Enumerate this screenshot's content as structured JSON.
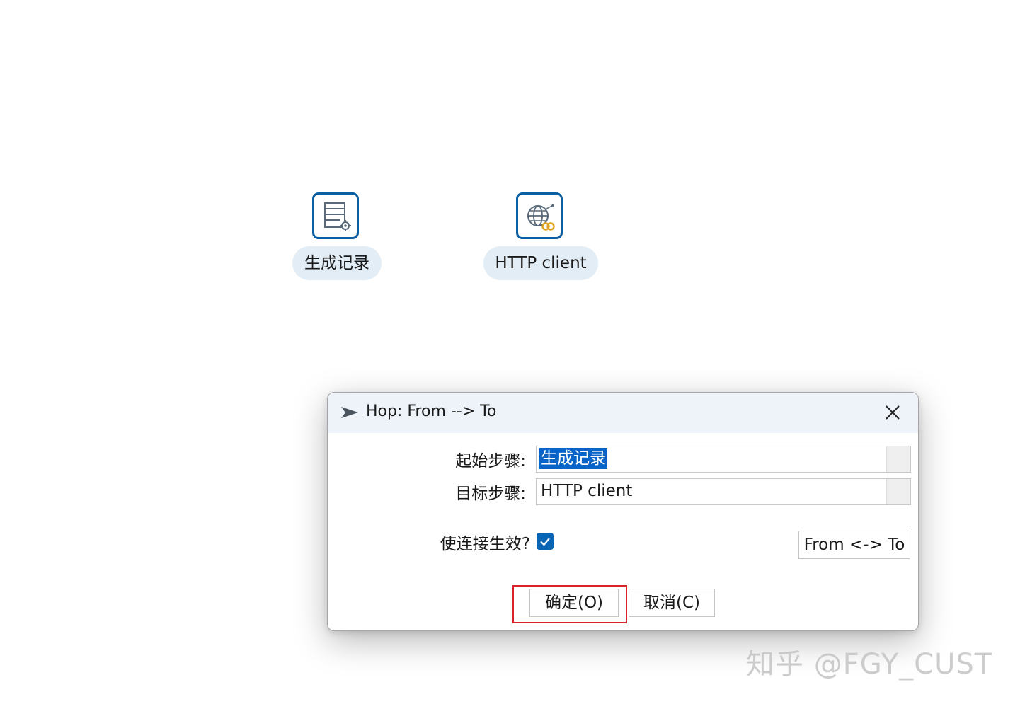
{
  "canvas": {
    "steps": [
      {
        "label": "生成记录",
        "icon": "generate-rows-icon"
      },
      {
        "label": "HTTP client",
        "icon": "http-client-icon"
      }
    ]
  },
  "dialog": {
    "title": "Hop: From --> To",
    "from_label": "起始步骤:",
    "from_value": "生成记录",
    "to_label": "目标步骤:",
    "to_value": "HTTP client",
    "enable_label": "使连接生效?",
    "enable_checked": true,
    "swap_button": "From <-> To",
    "ok_button": "确定(O)",
    "cancel_button": "取消(C)"
  },
  "watermark": "知乎 @FGY_CUST",
  "colors": {
    "accent": "#0b5fa5",
    "selection": "#0a64c8",
    "highlight": "#d8222a",
    "label_pill": "#e3edf6"
  }
}
